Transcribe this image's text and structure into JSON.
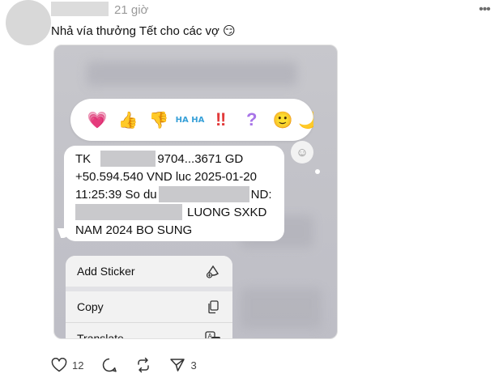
{
  "post": {
    "time": "21 giờ",
    "text": "Nhả vía thưởng Tết cho các vợ 😏"
  },
  "reactions": [
    "💗",
    "👍",
    "👎",
    "HA HA",
    "‼",
    "?",
    "🙂",
    "🌙"
  ],
  "message": {
    "l1a": "TK",
    "l1b": "9704...3671 GD",
    "l2": "+50.594.540 VND luc 2025-01-20",
    "l3a": "11:25:39 So du",
    "l3b": "ND:",
    "l4": "LUONG SXKD",
    "l5": "NAM 2024 BO SUNG"
  },
  "menu": {
    "add_sticker": "Add Sticker",
    "copy": "Copy",
    "translate": "Translate"
  },
  "actions": {
    "likes": "12",
    "shares": "3"
  },
  "icons": {
    "more": "more-icon",
    "like": "heart-icon",
    "reply": "comment-icon",
    "repost": "repost-icon",
    "share": "send-icon"
  }
}
